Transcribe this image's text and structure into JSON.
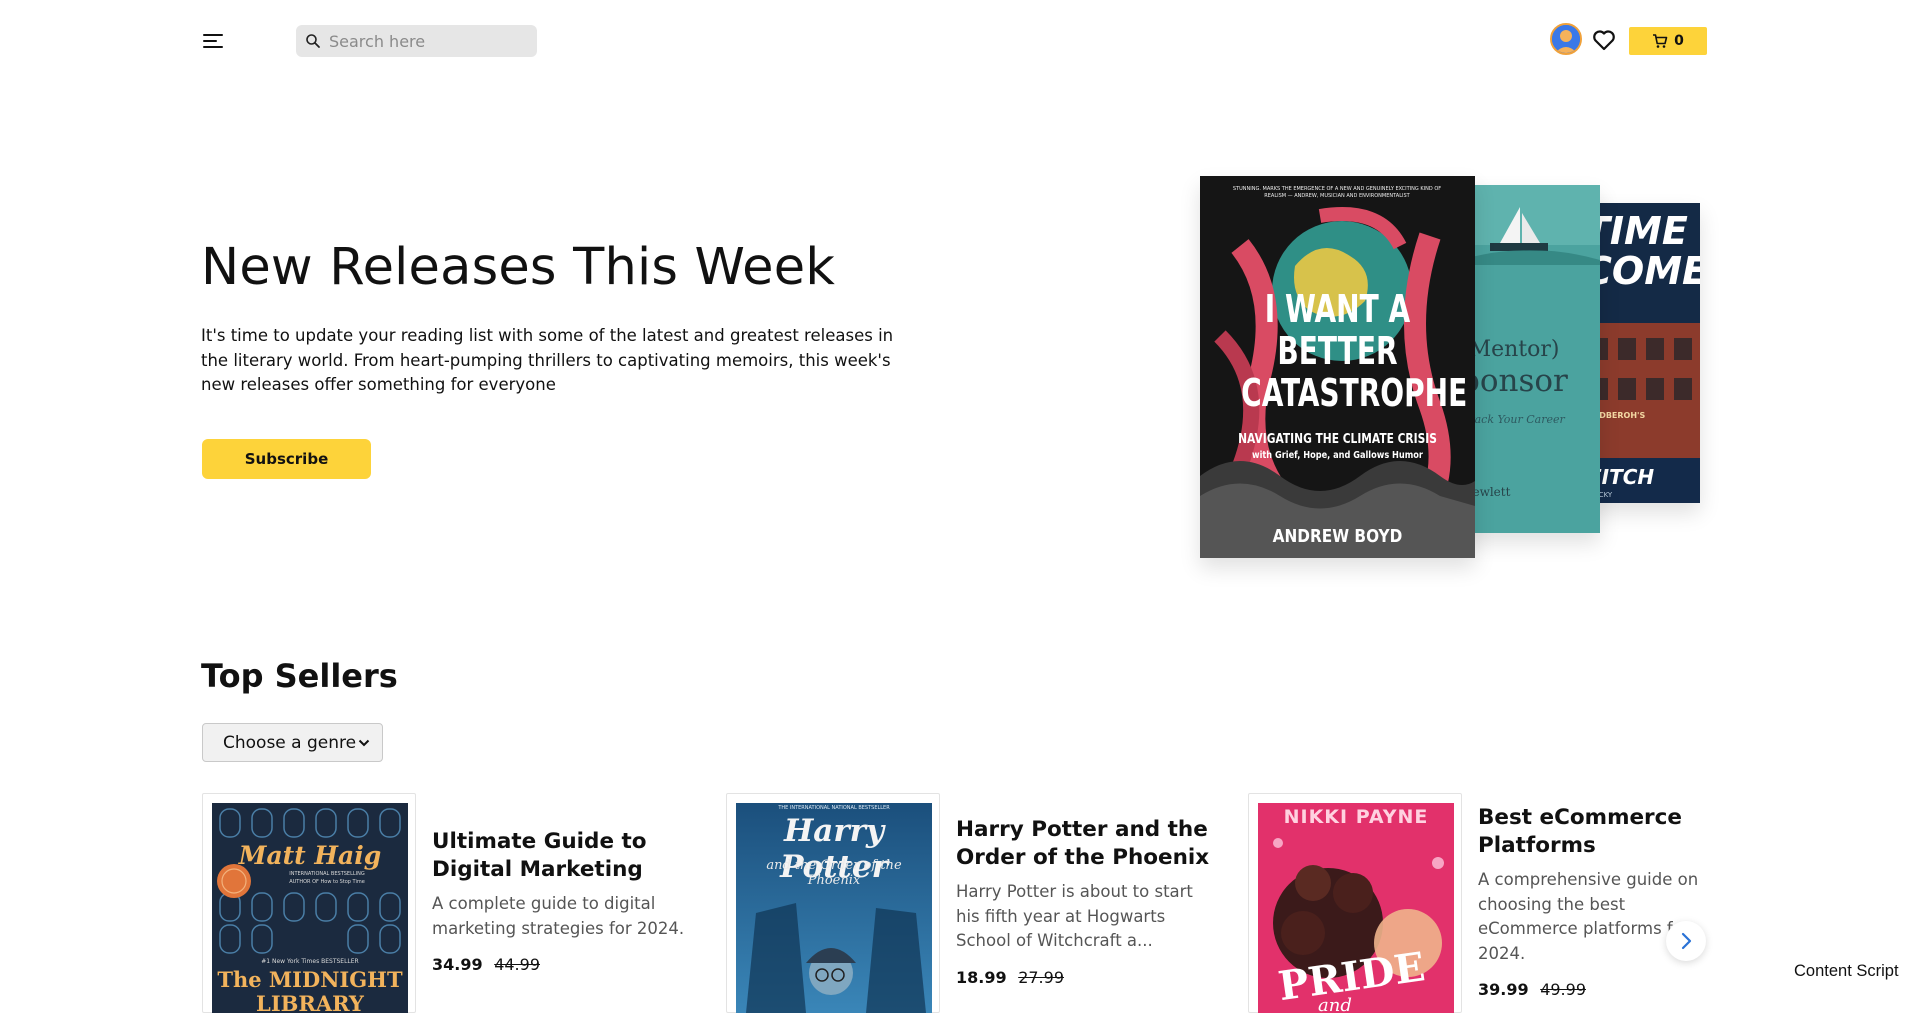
{
  "header": {
    "search_placeholder": "Search here",
    "cart_count": "0"
  },
  "hero": {
    "title": "New Releases This Week",
    "description": "It's time to update your reading list with some of the latest and greatest releases in the literary world. From heart-pumping thrillers to captivating memoirs, this week's new releases offer something for everyone",
    "subscribe_label": "Subscribe",
    "books": [
      {
        "cover_title": "I WANT A BETTER CATASTROPHE",
        "cover_subtitle": "NAVIGATING THE CLIMATE CRISIS",
        "cover_tagline": "with Grief, Hope, and Gallows Humor",
        "cover_author": "ANDREW BOYD",
        "cover_blurb": "STUNNING. MARKS THE EMERGENCE OF A NEW AND GENUINELY EXCITING KIND OF REALISM — ANDREW, MUSICIAN AND ENVIRONMENTALIST"
      },
      {
        "cover_title_line1": "(Mentor)",
        "cover_title_line2": "ponsor",
        "cover_subtitle": "Track Your Career",
        "cover_author": "Hewlett"
      },
      {
        "cover_title_line1": "TIME",
        "cover_title_line2": "COME",
        "cover_sign": "UNDBEROH'S",
        "cover_author": "EITCH",
        "cover_note": "LUCKY"
      }
    ]
  },
  "top_sellers": {
    "title": "Top Sellers",
    "genre_selected": "Choose a genre",
    "products": [
      {
        "title": "Ultimate Guide to Digital Marketing",
        "description": "A complete guide to digital marketing strategies for 2024.",
        "price": "34.99",
        "old_price": "44.99",
        "cover_author": "Matt Haig",
        "cover_line1": "INTERNATIONAL BESTSELLING",
        "cover_line2": "AUTHOR OF How to Stop Time",
        "cover_line3": "#1 New York Times BESTSELLER",
        "cover_title_line1": "The MIDNIGHT",
        "cover_title_line2": "LIBRARY"
      },
      {
        "title": "Harry Potter and the Order of the Phoenix",
        "description": "Harry Potter is about to start his fifth year at Hogwarts School of Witchcraft a...",
        "price": "18.99",
        "old_price": "27.99",
        "cover_banner": "THE INTERNATIONAL NATIONAL BESTSELLER",
        "cover_title": "Harry Potter",
        "cover_subtitle": "and the Order of the Phoenix"
      },
      {
        "title": "Best eCommerce Platforms",
        "description": "A comprehensive guide on choosing the best eCommerce platforms for 2024.",
        "price": "39.99",
        "old_price": "49.99",
        "cover_author": "NIKKI PAYNE",
        "cover_title_line1": "PRIDE",
        "cover_title_line2": "and"
      }
    ]
  },
  "footer_label": "Content Script",
  "colors": {
    "accent": "#fdd33a",
    "text": "#111111",
    "muted": "#555555"
  }
}
